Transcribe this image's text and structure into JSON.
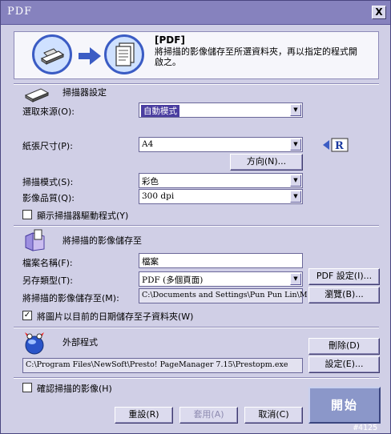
{
  "window": {
    "title": "PDF",
    "close_glyph": "X",
    "build_tag": "#4125"
  },
  "header": {
    "title": "[PDF]",
    "description": "將掃描的影像儲存至所選資料夾，再以指定的程式開啟之。",
    "icons": [
      "scanner-icon",
      "arrow-right-icon",
      "document-icon"
    ]
  },
  "scanner_settings": {
    "title": "掃描器設定",
    "source": {
      "label": "選取來源(O):",
      "value": "自動模式"
    },
    "paper_size": {
      "label": "紙張尺寸(P):",
      "value": "A4"
    },
    "orientation_button": "方向(N)...",
    "scan_mode": {
      "label": "掃描模式(S):",
      "value": "彩色"
    },
    "quality": {
      "label": "影像品質(Q):",
      "value": "300 dpi"
    },
    "show_driver": {
      "label": "顯示掃描器驅動程式(Y)",
      "checked": false
    }
  },
  "save_settings": {
    "title": "將掃描的影像儲存至",
    "filename": {
      "label": "檔案名稱(F):",
      "value": "檔案"
    },
    "save_type": {
      "label": "另存類型(T):",
      "value": "PDF (多個頁面)"
    },
    "pdf_settings_button": "PDF 設定(I)...",
    "save_to": {
      "label": "將掃描的影像儲存至(M):",
      "value": "C:\\Documents and Settings\\Pun Pun Lin\\M"
    },
    "browse_button": "瀏覽(B)...",
    "date_subfolder": {
      "label": "將圖片以目前的日期儲存至子資料夾(W)",
      "checked": true
    }
  },
  "external_program": {
    "title": "外部程式",
    "remove_button": "刪除(D)",
    "path": "C:\\Program Files\\NewSoft\\Presto! PageManager 7.15\\Prestopm.exe",
    "settings_button": "設定(E)..."
  },
  "confirm_scan": {
    "label": "確認掃描的影像(H)",
    "checked": false
  },
  "footer": {
    "reset": "重設(R)",
    "apply": "套用(A)",
    "cancel": "取消(C)",
    "start": "開始"
  },
  "colors": {
    "titlebar": "#8682be",
    "window_bg": "#d0cfe6",
    "start_button": "#8b97c9",
    "selection": "#4a3ea0"
  }
}
